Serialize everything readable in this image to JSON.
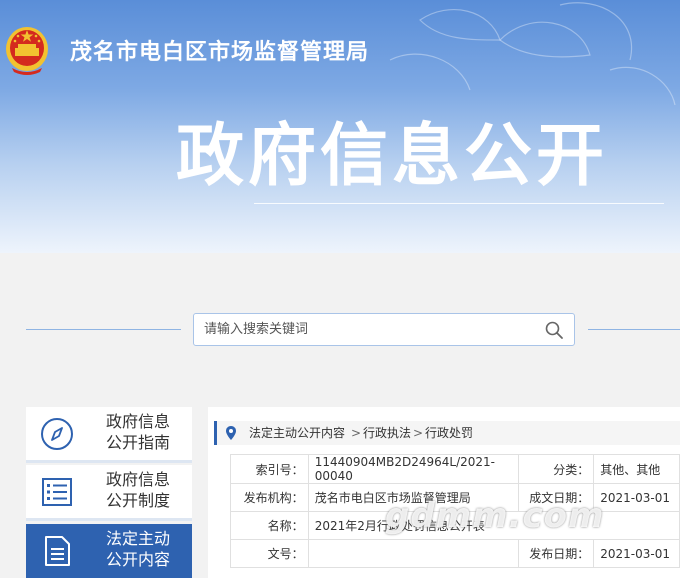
{
  "header": {
    "org_name": "茂名市电白区市场监督管理局",
    "page_title": "政府信息公开"
  },
  "search": {
    "placeholder": "请输入搜索关键词"
  },
  "sidebar": {
    "items": [
      {
        "label_line1": "政府信息",
        "label_line2": "公开指南",
        "icon": "compass-icon",
        "active": false
      },
      {
        "label_line1": "政府信息",
        "label_line2": "公开制度",
        "icon": "list-icon",
        "active": false
      },
      {
        "label_line1": "法定主动",
        "label_line2": "公开内容",
        "icon": "document-icon",
        "active": true
      }
    ]
  },
  "breadcrumb": {
    "items": [
      "法定主动公开内容",
      "行政执法",
      "行政处罚"
    ],
    "separator": ">"
  },
  "info": {
    "index_label": "索引号：",
    "index_value": "11440904MB2D24964L/2021-00040",
    "category_label": "分类：",
    "category_value": "其他、其他",
    "publisher_label": "发布机构：",
    "publisher_value": "茂名市电白区市场监督管理局",
    "created_label": "成文日期：",
    "created_value": "2021-03-01",
    "name_label": "名称：",
    "name_value": "2021年2月行政处罚信息公开表",
    "docno_label": "文号：",
    "docno_value": "",
    "published_label": "发布日期：",
    "published_value": "2021-03-01"
  },
  "watermark": "gdmm.com",
  "colors": {
    "primary": "#2e62b0",
    "banner_top": "#5a8ed8",
    "emblem_red": "#d42a1e",
    "emblem_gold": "#f2c230"
  }
}
